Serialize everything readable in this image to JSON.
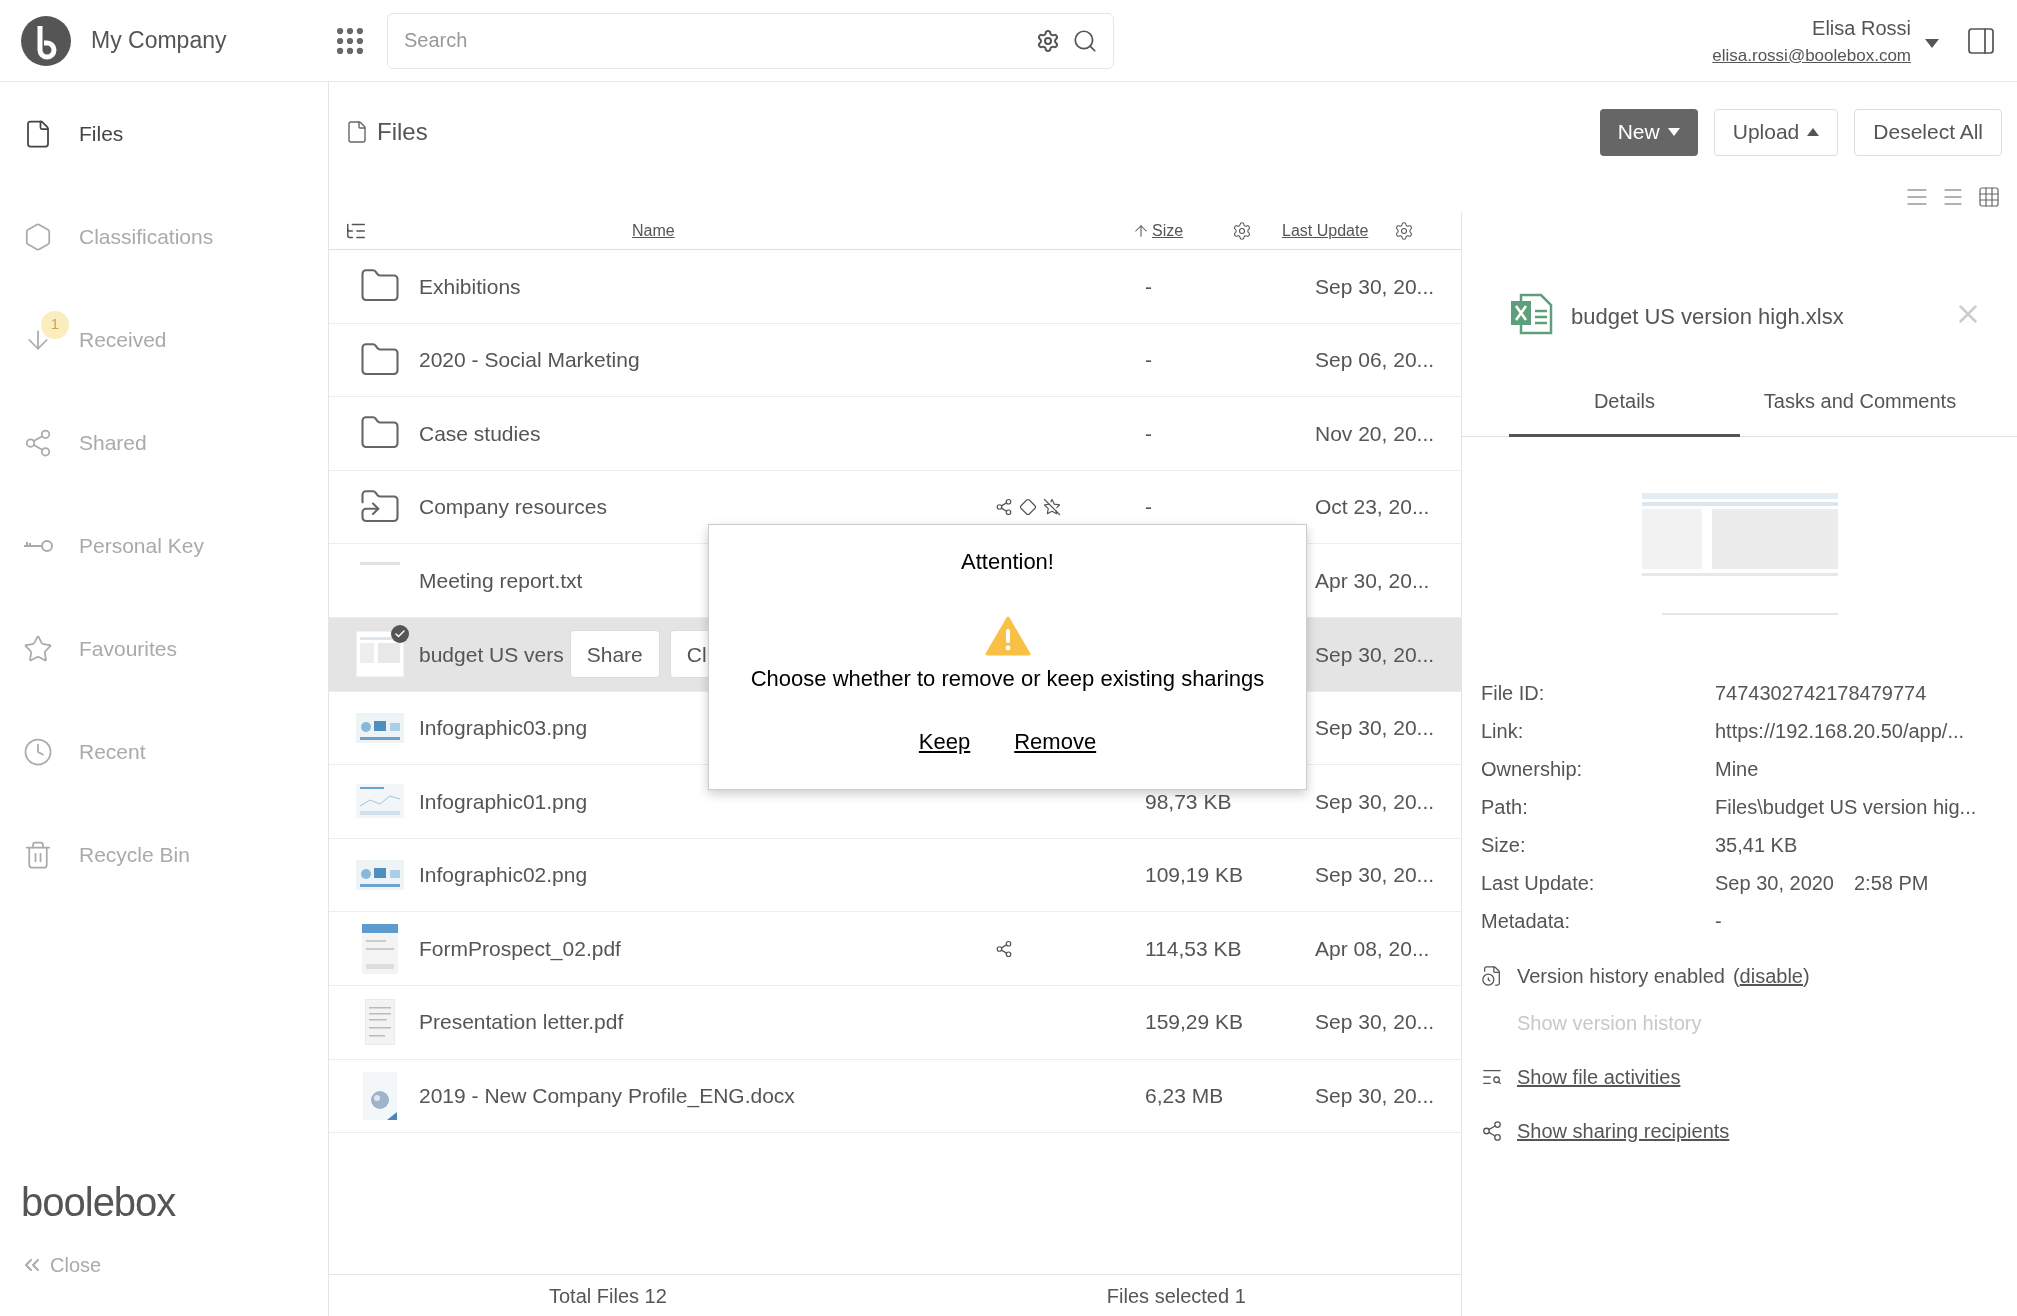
{
  "topbar": {
    "company": "My Company",
    "search": {
      "placeholder": "Search"
    },
    "user": {
      "name": "Elisa Rossi",
      "email": "elisa.rossi@boolebox.com"
    }
  },
  "sidebar": {
    "items": [
      {
        "label": "Files",
        "selected": true
      },
      {
        "label": "Classifications",
        "selected": false
      },
      {
        "label": "Received",
        "selected": false,
        "badge": "1"
      },
      {
        "label": "Shared",
        "selected": false
      },
      {
        "label": "Personal Key",
        "selected": false
      },
      {
        "label": "Favourites",
        "selected": false
      },
      {
        "label": "Recent",
        "selected": false
      },
      {
        "label": "Recycle Bin",
        "selected": false
      }
    ],
    "logo": "boolebox",
    "close": "Close"
  },
  "main": {
    "title": "Files",
    "buttons": [
      {
        "label": "New",
        "kind": "primary"
      },
      {
        "label": "Upload",
        "kind": "secondary"
      },
      {
        "label": "Deselect All",
        "kind": "secondary"
      }
    ],
    "columns": [
      {
        "label": "Name",
        "sorted": false
      },
      {
        "label": "Size",
        "sorted": true
      },
      {
        "label": "Last Update",
        "sorted": false
      }
    ],
    "rows": [
      {
        "name": "Exhibitions",
        "kind": "folder",
        "size": "-",
        "date": "Sep 30, 20...",
        "shared": false,
        "selected": false
      },
      {
        "name": "2020 - Social Marketing",
        "kind": "folder",
        "size": "-",
        "date": "Sep 06, 20...",
        "shared": false,
        "selected": false
      },
      {
        "name": "Case studies",
        "kind": "folder",
        "size": "-",
        "date": "Nov 20, 20...",
        "shared": false,
        "selected": false
      },
      {
        "name": "Company resources",
        "kind": "shared-folder",
        "size": "-",
        "date": "Oct 23, 20...",
        "shared": true,
        "selected": false
      },
      {
        "name": "Meeting report.txt",
        "kind": "blank",
        "date": "Apr 30, 20...",
        "shared": false,
        "selected": false
      },
      {
        "name": "budget US vers",
        "kind": "sheet",
        "date": "Sep 30, 20...",
        "shared": false,
        "selected": true,
        "actions": [
          "Share",
          "Cl"
        ]
      },
      {
        "name": "Infographic03.png",
        "kind": "infographic",
        "date": "Sep 30, 20...",
        "shared": false,
        "selected": false
      },
      {
        "name": "Infographic01.png",
        "kind": "chart",
        "size": "98,73 KB",
        "date": "Sep 30, 20...",
        "shared": false,
        "selected": false
      },
      {
        "name": "Infographic02.png",
        "kind": "infographic",
        "size": "109,19 KB",
        "date": "Sep 30, 20...",
        "shared": false,
        "selected": false
      },
      {
        "name": "FormProspect_02.pdf",
        "kind": "form",
        "size": "114,53 KB",
        "date": "Apr 08, 20...",
        "shared": true,
        "selected": false
      },
      {
        "name": "Presentation letter.pdf",
        "kind": "letter",
        "size": "159,29 KB",
        "date": "Sep 30, 20...",
        "shared": false,
        "selected": false
      },
      {
        "name": "2019 - New Company Profile_ENG.docx",
        "kind": "cover",
        "size": "6,23 MB",
        "date": "Sep 30, 20...",
        "shared": false,
        "selected": false
      }
    ],
    "footer": {
      "total": "Total Files 12",
      "selected": "Files selected 1"
    }
  },
  "dialog": {
    "title": "Attention!",
    "message": "Choose whether to remove or keep existing sharings",
    "actions": [
      "Keep",
      "Remove"
    ]
  },
  "details": {
    "title": "budget US version high.xlsx",
    "tabs": [
      {
        "label": "Details",
        "selected": true
      },
      {
        "label": "Tasks and Comments",
        "selected": false
      }
    ],
    "fields": [
      {
        "label": "File ID:",
        "value": "7474302742178479774"
      },
      {
        "label": "Link:",
        "value": "https://192.168.20.50/app/..."
      },
      {
        "label": "Ownership:",
        "value": "Mine"
      },
      {
        "label": "Path:",
        "value": "Files\\budget US version hig..."
      },
      {
        "label": "Size:",
        "value": "35,41 KB"
      },
      {
        "label": "Last Update:",
        "value": "Sep 30, 2020",
        "time": "2:58 PM"
      },
      {
        "label": "Metadata:",
        "value": "-"
      }
    ],
    "version": {
      "text": "Version history enabled",
      "paren_open": "(",
      "link": "disable",
      "paren_close": ")"
    },
    "links": [
      {
        "label": "Show version history",
        "disabled": true
      },
      {
        "label": "Show file activities",
        "disabled": false
      },
      {
        "label": "Show sharing recipients",
        "disabled": false
      }
    ]
  }
}
